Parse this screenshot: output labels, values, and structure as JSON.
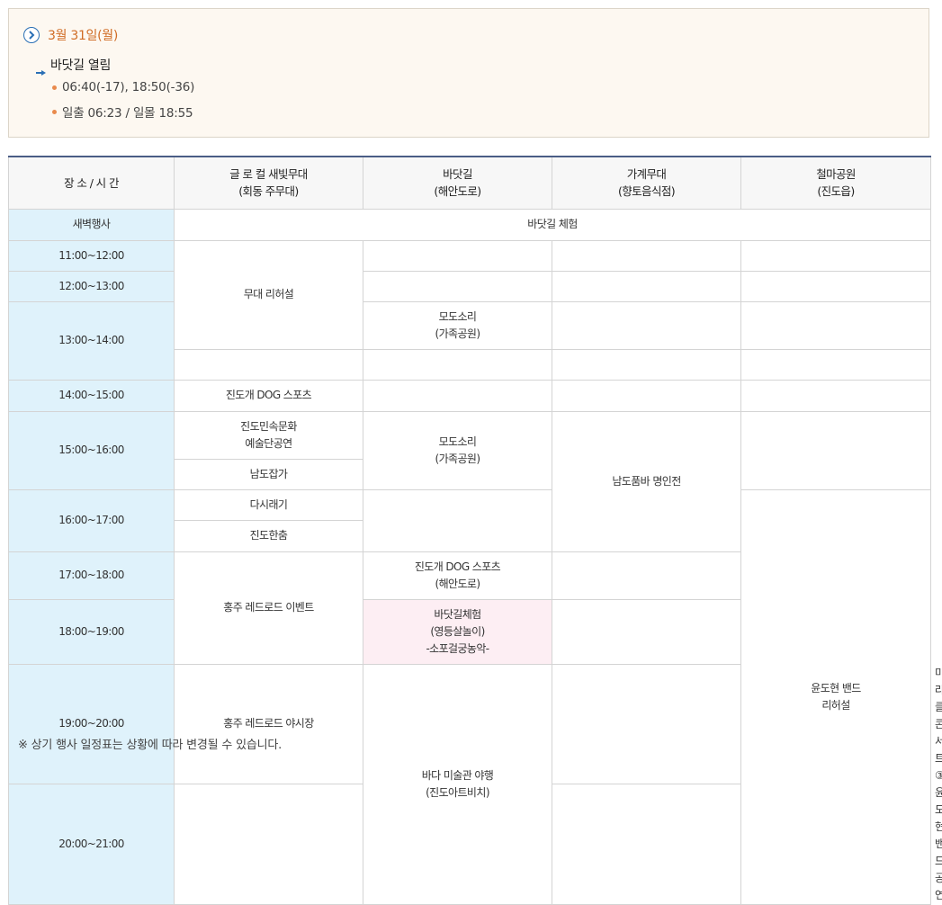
{
  "date": "3월 31일(월)",
  "opening": {
    "title": "바닷길 열림",
    "bullets": [
      "06:40(-17), 18:50(-36)",
      "일출 06:23 / 일몰 18:55"
    ]
  },
  "colors": {
    "accent_date": "#d06c25",
    "header_border": "#4a5d86",
    "time_bg": "#dff2fb",
    "highlight_bg": "#fdeef3",
    "bullet": "#e98a4c"
  },
  "table": {
    "headers": [
      {
        "line1": "장 소 / 시 간",
        "line2": ""
      },
      {
        "line1": "글 로 컬 새빛무대",
        "line2": "(회동 주무대)"
      },
      {
        "line1": "바닷길",
        "line2": "(해안도로)"
      },
      {
        "line1": "가계무대",
        "line2": "(향토음식점)"
      },
      {
        "line1": "철마공원",
        "line2": "(진도읍)"
      }
    ],
    "times": [
      "새벽행사",
      "11:00~12:00",
      "12:00~13:00",
      "13:00~14:00",
      "14:00~15:00",
      "15:00~16:00",
      "16:00~17:00",
      "17:00~18:00",
      "18:00~19:00",
      "19:00~20:00",
      "20:00~21:00"
    ],
    "events": {
      "dawn": "바닷길 체험",
      "rehearsal": "무대 리허설",
      "modo1": {
        "l1": "모도소리",
        "l2": "(가족공원)"
      },
      "dog1": "진도개 DOG 스포츠",
      "folk": {
        "l1": "진도민속문화",
        "l2": "예술단공연"
      },
      "modo2": {
        "l1": "모도소리",
        "l2": "(가족공원)"
      },
      "namdo_japga": "남도잡가",
      "pumba": "남도품바 명인전",
      "dasiraegi": "다시래기",
      "jindo_dance": "진도한춤",
      "dog2": {
        "l1": "진도개 DOG 스포츠",
        "l2": "(해안도로)"
      },
      "band_rehearsal": {
        "l1": "윤도현 밴드",
        "l2": "리허설"
      },
      "red_event": "홍주 레드로드 이벤트",
      "sea_exp": {
        "l1": "바닷길체험",
        "l2": "(영등살놀이)",
        "l3": "-소포걸궁농악-"
      },
      "red_market": "홍주 레드로드 야시장",
      "museum": {
        "l1": "바다 미술관 야행",
        "l2": "(진도아트비치)"
      },
      "concert": {
        "l1": "미라클 콘서트③",
        "l2": "윤도현 밴드공연"
      }
    }
  },
  "note": "※ 상기 행사 일정표는 상황에 따라 변경될 수 있습니다."
}
